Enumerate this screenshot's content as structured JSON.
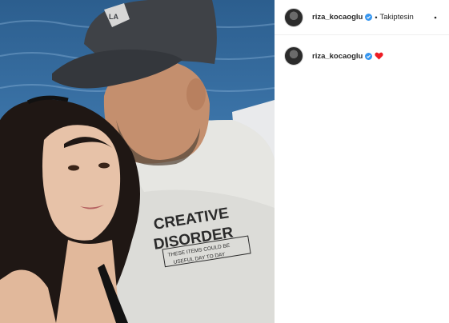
{
  "post": {
    "username": "riza_kocaoglu",
    "follow_status": "Takiptesin",
    "separator": "•",
    "more_label": "•••",
    "caption_username": "riza_kocaoglu"
  },
  "photo": {
    "shirt_line1": "CREATIVE",
    "shirt_line2": "DISORDER",
    "shirt_tag_line1": "THESE ITEMS COULD BE",
    "shirt_tag_line2": "USEFUL DAY TO DAY",
    "cap_logo": "LA"
  },
  "colors": {
    "verified_blue": "#3897f0",
    "heart_red": "#ed1c24",
    "sea_blue": "#3a72a6"
  },
  "icons": {
    "verified": "verified-badge-icon",
    "heart": "red-heart-icon",
    "more": "more-options-icon"
  }
}
